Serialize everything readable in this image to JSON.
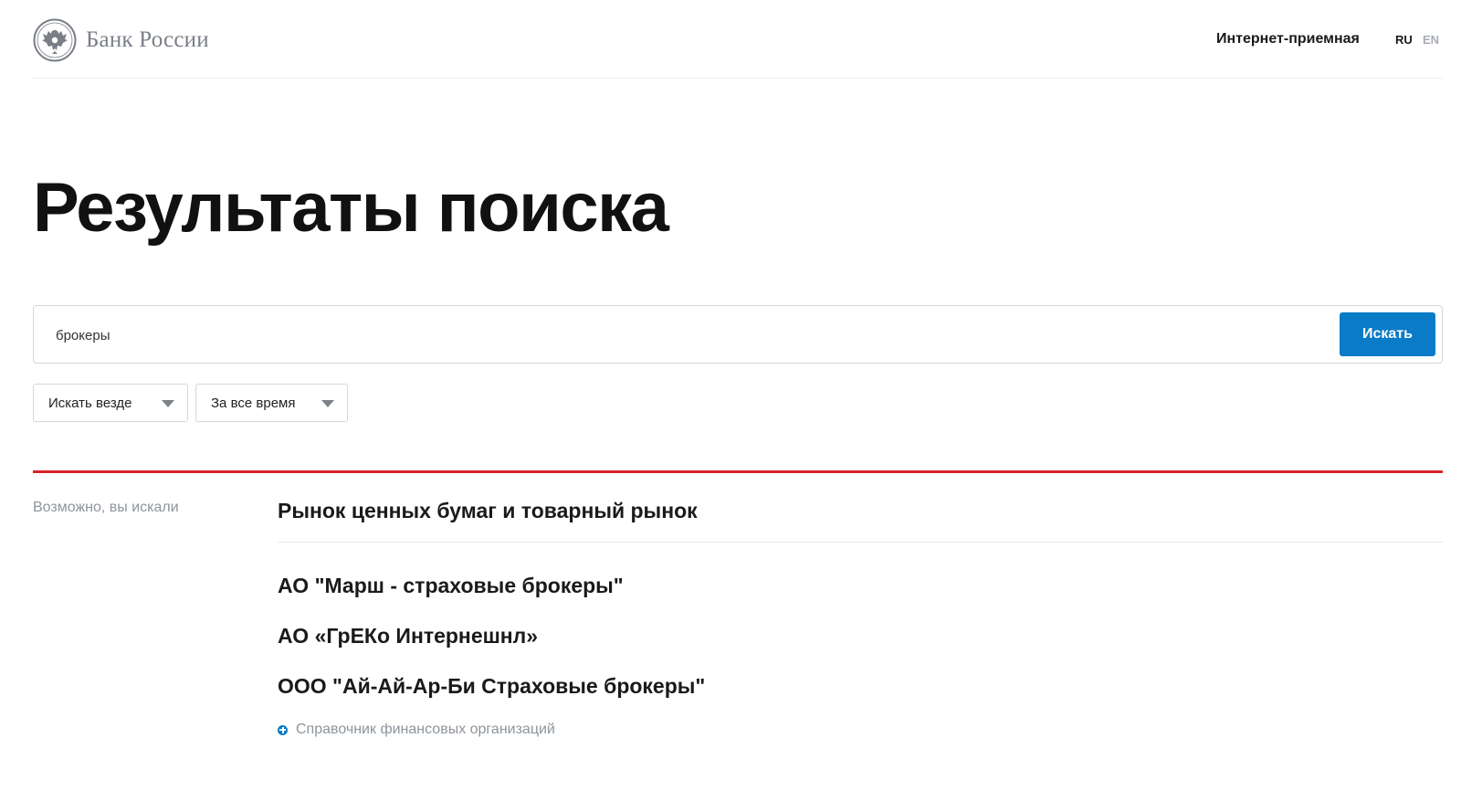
{
  "header": {
    "logo_text": "Банк России",
    "logo_icon": "double-headed-eagle-emblem",
    "reception_link": "Интернет-приемная",
    "languages": {
      "ru": "RU",
      "en": "EN",
      "active": "RU"
    }
  },
  "main": {
    "title": "Результаты поиска",
    "search": {
      "value": "брокеры",
      "button_label": "Искать"
    },
    "filters": {
      "where": {
        "selected": "Искать везде",
        "icon": "caret-down-icon"
      },
      "time": {
        "selected": "За все время",
        "icon": "caret-down-icon"
      }
    },
    "suggest_label": "Возможно, вы искали",
    "top_result": "Рынок ценных бумаг и товарный рынок",
    "results": [
      "АО \"Марш - страховые брокеры\"",
      "АО «ГрЕКо Интернешнл»",
      "ООО \"Ай-Ай-Ар-Би Страховые брокеры\""
    ],
    "category": {
      "label": "Справочник финансовых организаций",
      "icon": "plus-circle-icon"
    }
  },
  "colors": {
    "accent": "#0a7bc6",
    "divider_red": "#d8232a",
    "muted_text": "#8e949b",
    "logo_gray": "#7a7f87"
  }
}
